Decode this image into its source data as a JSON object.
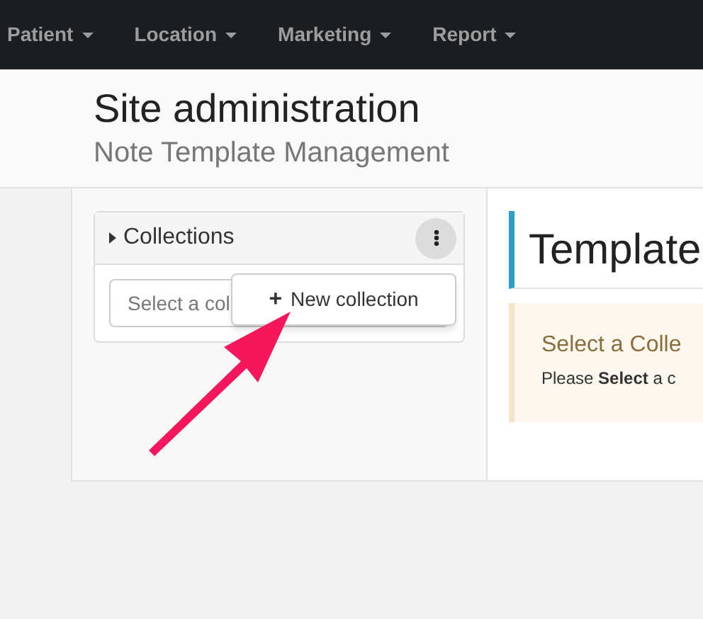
{
  "navbar": {
    "items": [
      {
        "label": "Patient"
      },
      {
        "label": "Location"
      },
      {
        "label": "Marketing"
      },
      {
        "label": "Report"
      }
    ]
  },
  "header": {
    "title": "Site administration",
    "subtitle": "Note Template Management"
  },
  "collections_panel": {
    "title": "Collections",
    "expanded": false,
    "select": {
      "placeholder": "Select a col"
    },
    "menu": {
      "items": [
        {
          "icon": "+",
          "label": "New collection"
        }
      ]
    }
  },
  "template_panel": {
    "title": "Template",
    "alert": {
      "title": "Select a Colle",
      "message": "Please **Select** a c"
    }
  }
}
